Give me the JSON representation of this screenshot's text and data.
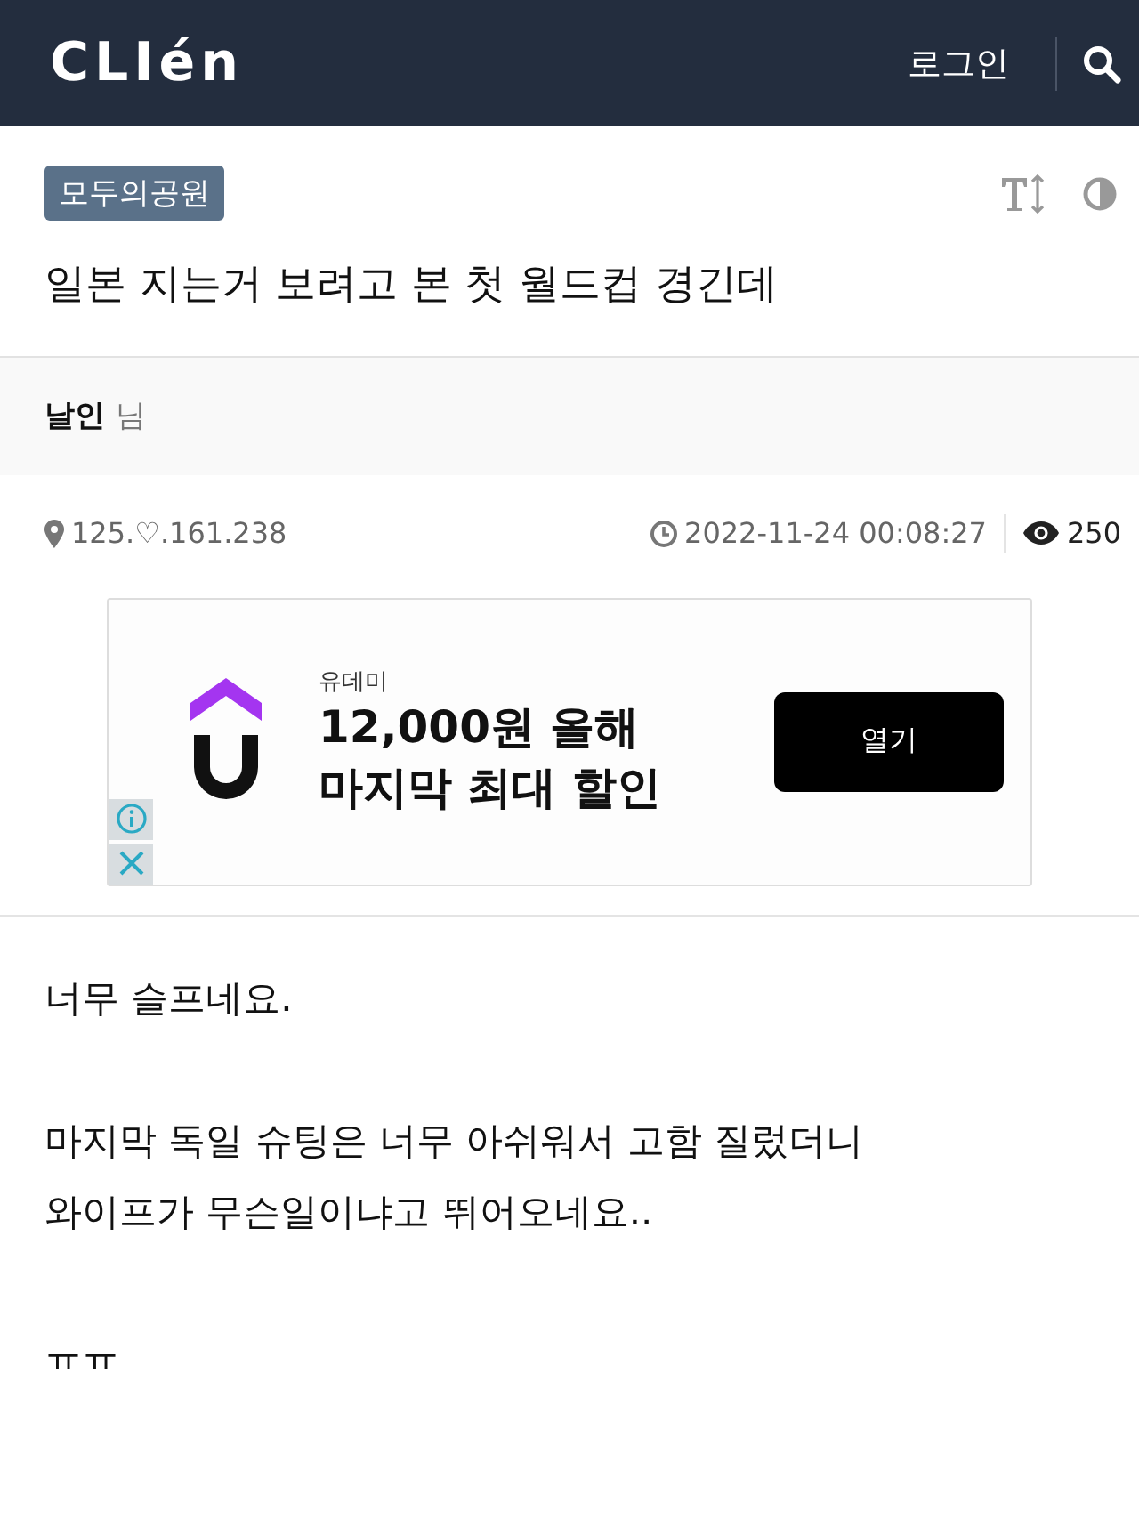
{
  "header": {
    "logo": "CLIén",
    "login": "로그인"
  },
  "post": {
    "board": "모두의공원",
    "title": "일본 지는거 보려고 본 첫 월드컵 경긴데",
    "author": "날인",
    "author_suffix": "님",
    "ip": "125.♡.161.238",
    "datetime": "2022-11-24 00:08:27",
    "views": "250"
  },
  "ad": {
    "advertiser": "유데미",
    "headline": [
      "12,000원 올해",
      "마지막 최대 할인"
    ],
    "button": "열기"
  },
  "body": [
    {
      "kind": "line",
      "text": "너무 슬프네요."
    },
    {
      "kind": "blank"
    },
    {
      "kind": "line",
      "text": "마지막 독일 슈팅은 너무 아쉬워서 고함 질렀더니"
    },
    {
      "kind": "line",
      "text": "와이프가 무슨일이냐고 뛰어오네요.."
    },
    {
      "kind": "blank"
    },
    {
      "kind": "line",
      "text": "ㅠㅠ"
    }
  ]
}
